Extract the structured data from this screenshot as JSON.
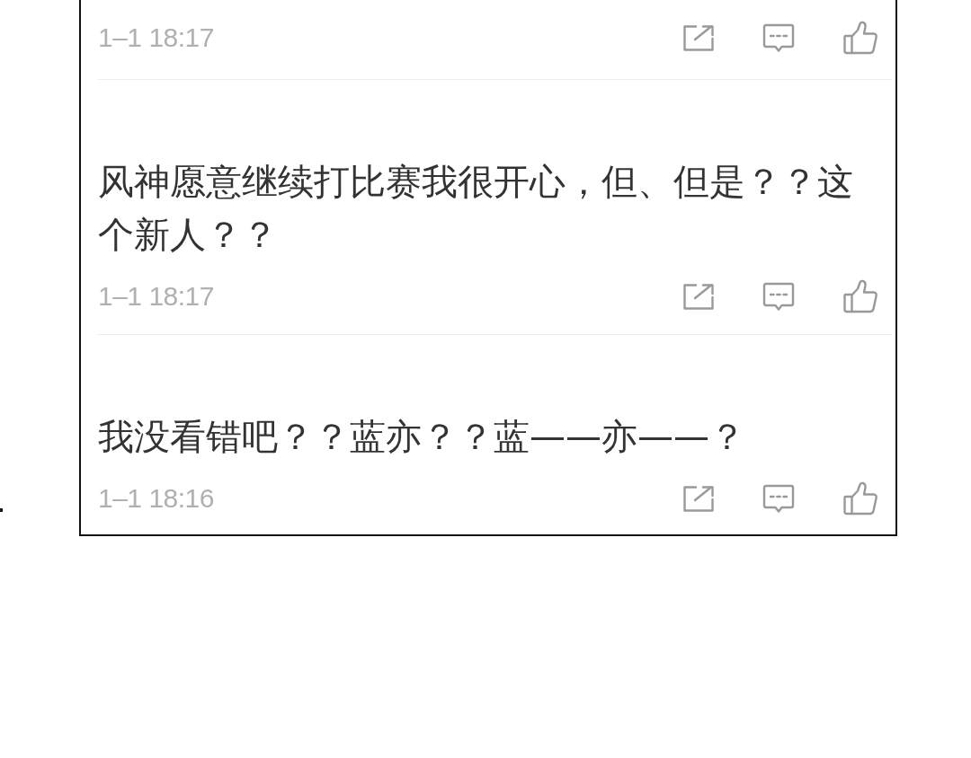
{
  "comments": [
    {
      "time": "1–1 18:17"
    },
    {
      "text": "风神愿意继续打比赛我很开心，但、但是？？这个新人？？",
      "time": "1–1 18:17"
    },
    {
      "text": "我没看错吧？？蓝亦？？蓝——亦——？",
      "time": "1–1 18:16"
    }
  ]
}
